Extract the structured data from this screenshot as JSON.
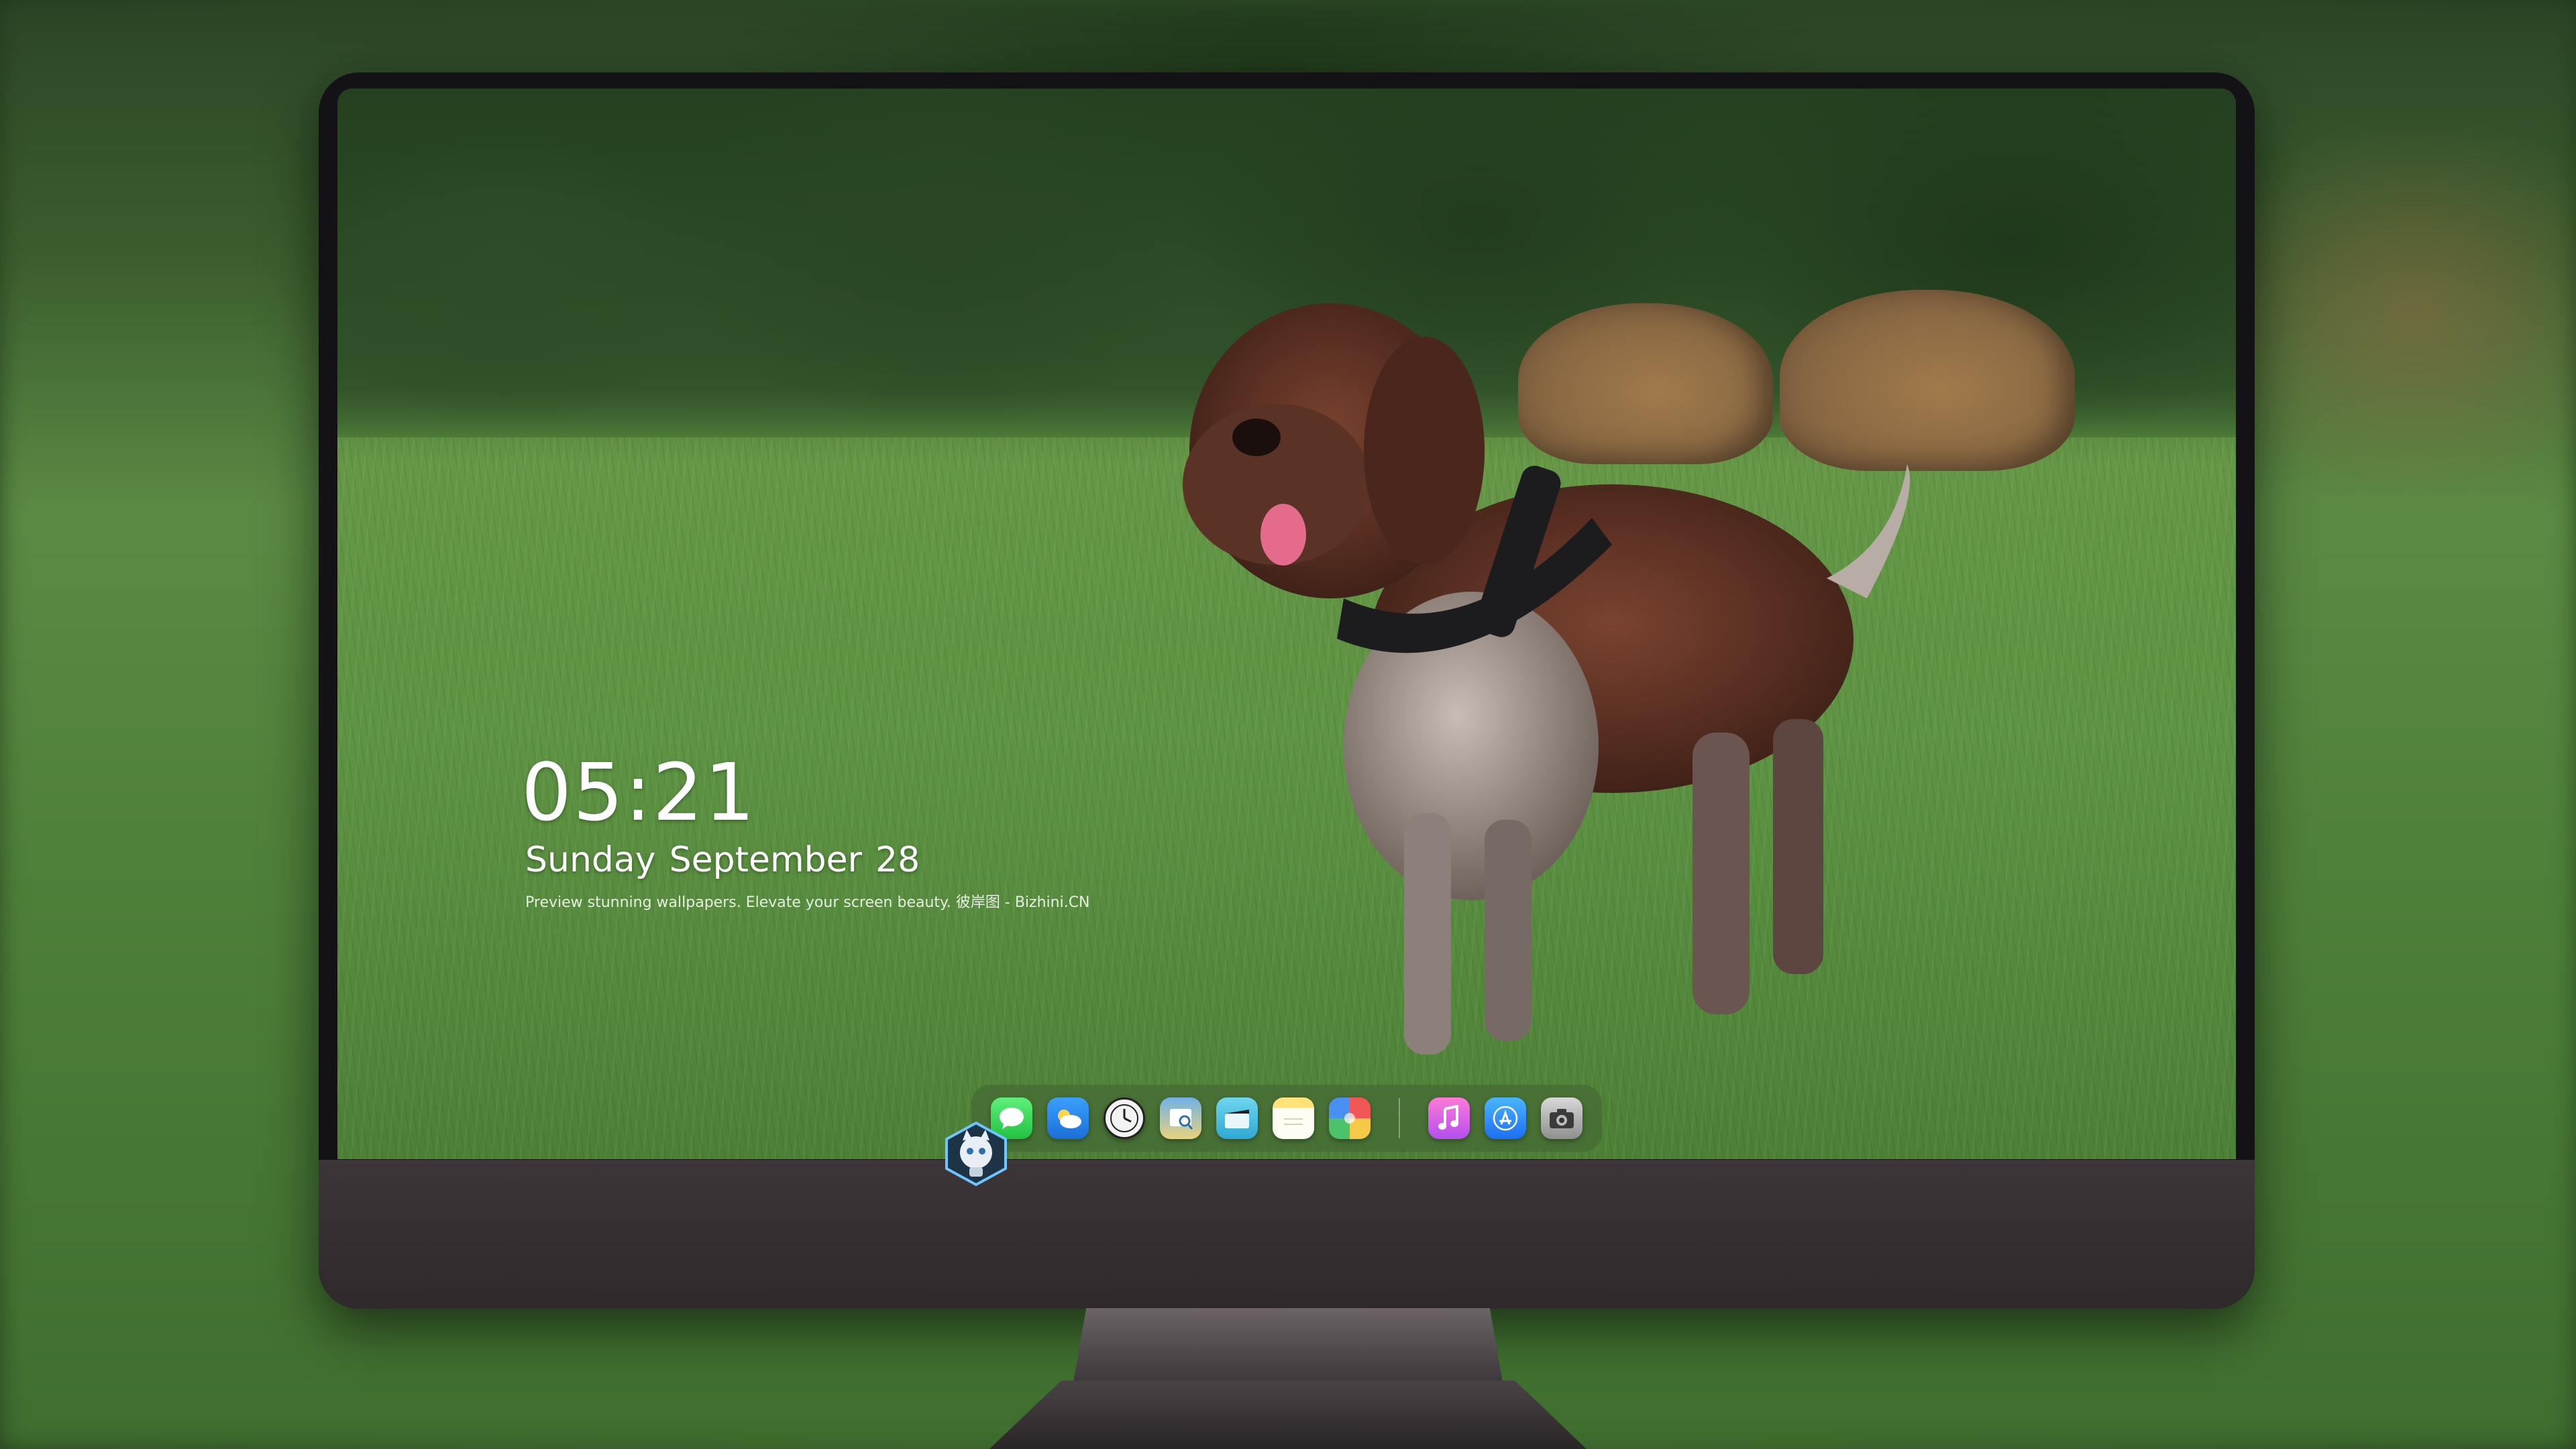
{
  "lockscreen": {
    "time": "05:21",
    "date": {
      "weekday": "Sunday",
      "month": "September",
      "day": "28"
    },
    "caption": "Preview stunning wallpapers. Elevate your screen beauty. 彼岸图 - Bizhini.CN"
  },
  "dock": {
    "apps": [
      {
        "name": "messages-icon",
        "color": "#2fd24f"
      },
      {
        "name": "weather-icon",
        "color": "#2b8af0"
      },
      {
        "name": "clock-icon",
        "color": "#f3f3f3"
      },
      {
        "name": "preview-icon",
        "color": "#6fb1e8"
      },
      {
        "name": "clips-icon",
        "color": "#38b7e0"
      },
      {
        "name": "notes-icon",
        "color": "#ffe27a"
      },
      {
        "name": "photos-icon",
        "color": "#f7c948"
      },
      {
        "name": "music-icon",
        "color": "#d86af0"
      },
      {
        "name": "app-store-icon",
        "color": "#2f8bf7"
      },
      {
        "name": "camera-icon",
        "color": "#b0b0b0"
      }
    ]
  },
  "brand": {
    "logo": "robot-cat-logo"
  }
}
